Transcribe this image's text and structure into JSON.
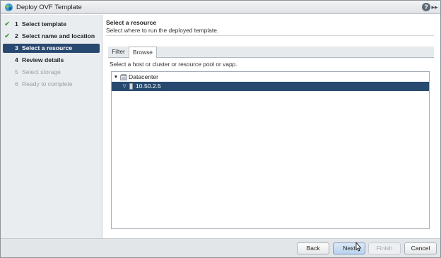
{
  "window": {
    "title": "Deploy OVF Template",
    "help_glyph": "?",
    "expand_glyph": "▸▸"
  },
  "nav": {
    "items": [
      {
        "check": "✔",
        "number": "1",
        "label": "Select template",
        "state": "done"
      },
      {
        "check": "✔",
        "number": "2",
        "label": "Select name and location",
        "state": "done"
      },
      {
        "check": "",
        "number": "3",
        "label": "Select a resource",
        "state": "current"
      },
      {
        "check": "",
        "number": "4",
        "label": "Review details",
        "state": "next"
      },
      {
        "check": "",
        "number": "5",
        "label": "Select storage",
        "state": "disabled"
      },
      {
        "check": "",
        "number": "6",
        "label": "Ready to complete",
        "state": "disabled"
      }
    ]
  },
  "main": {
    "heading": "Select a resource",
    "subheading": "Select where to run the deployed template.",
    "tabs": [
      {
        "label": "Filter",
        "selected": false
      },
      {
        "label": "Browse",
        "selected": true
      }
    ],
    "instruction": "Select a host or cluster or resource pool or vapp.",
    "tree": [
      {
        "label": "Datacenter",
        "toggle": "▼",
        "type": "datacenter",
        "selected": false
      },
      {
        "label": "10.50.2.5",
        "toggle": "▽",
        "type": "host",
        "selected": true
      }
    ]
  },
  "footer": {
    "back_label": "Back",
    "next_label": "Next",
    "finish_label": "Finish",
    "cancel_label": "Cancel"
  },
  "colors": {
    "selection": "#28496f",
    "check": "#3c9a2e",
    "nav_bg": "#eaedf0"
  }
}
